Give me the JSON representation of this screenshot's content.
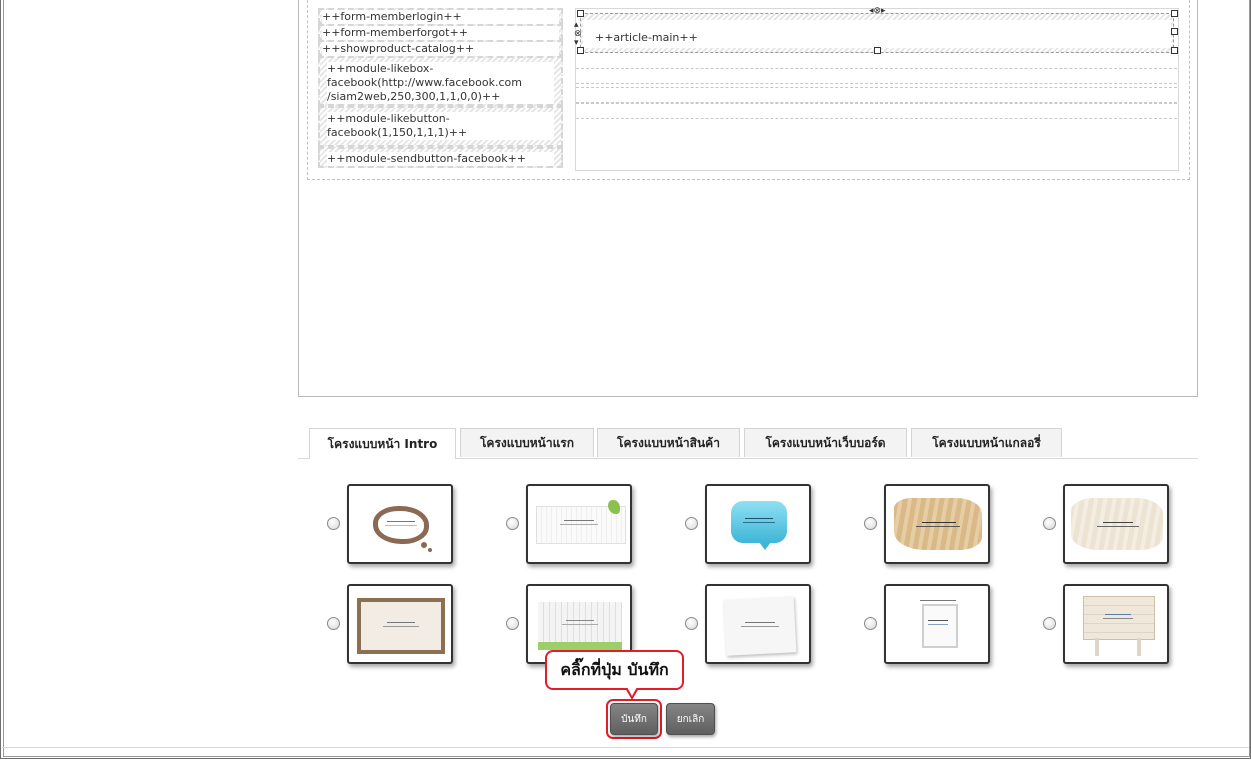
{
  "editor": {
    "left_modules": [
      "++form-memberlogin++",
      "++form-memberforgot++",
      "++showproduct-catalog++",
      "++module-likebox-facebook(http://www.facebook.com/siam2web,250,300,1,1,0,0)++",
      "++module-likebutton-facebook(1,150,1,1,1)++",
      "++module-sendbutton-facebook++"
    ],
    "likebox_lines": [
      "++module-likebox-",
      "facebook(http://www.facebook.com",
      "/siam2web,250,300,1,1,0,0)++"
    ],
    "likebutton_lines": [
      "++module-likebutton-",
      "facebook(1,150,1,1,1)++"
    ],
    "article_main": "++article-main++"
  },
  "tabs": [
    {
      "label": "โครงแบบหน้า Intro",
      "active": true
    },
    {
      "label": "โครงแบบหน้าแรก",
      "active": false
    },
    {
      "label": "โครงแบบหน้าสินค้า",
      "active": false
    },
    {
      "label": "โครงแบบหน้าเว็บบอร์ด",
      "active": false
    },
    {
      "label": "โครงแบบหน้าแกลอรี่",
      "active": false
    }
  ],
  "templates": {
    "row1": [
      "cloud-template-icon",
      "grass-banner-template-icon",
      "blue-bubble-template-icon",
      "beige-brush-template-icon",
      "cream-brush-template-icon"
    ],
    "row2": [
      "wood-frame-template-icon",
      "white-fence-template-icon",
      "paper-note-template-icon",
      "hanging-sign-template-icon",
      "wooden-board-template-icon"
    ]
  },
  "callout": {
    "text": "คลิ๊กที่ปุ่ม บันทึก"
  },
  "buttons": {
    "save_label": "บันทึก",
    "cancel_label": "ยกเลิก"
  },
  "colors": {
    "highlight": "#e21d2a",
    "button": "#6e6e6e"
  }
}
